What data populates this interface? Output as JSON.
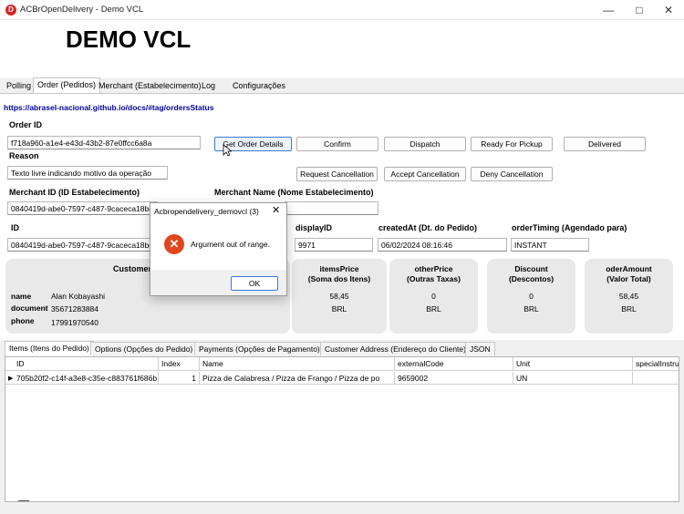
{
  "window": {
    "title": "ACBrOpenDelivery - Demo VCL"
  },
  "header": {
    "title": "DEMO VCL"
  },
  "tabs": [
    "Polling",
    "Order (Pedidos)",
    "Merchant (Estabelecimento)",
    "Log",
    "Configurações"
  ],
  "order": {
    "link": "https://abrasel-nacional.github.io/docs/#tag/ordersStatus",
    "order_id_label": "Order ID",
    "order_id": "f718a960-a1e4-e43d-43b2-87e0ffcc6a8a",
    "reason_label": "Reason",
    "reason": "Texto livre indicando motivo da operação",
    "merchant_id_label": "Merchant ID (ID Estabelecimento)",
    "merchant_id": "0840419d-abe0-7597-c487-9caceca18bed",
    "merchant_name_label": "Merchant Name (Nome Estabelecimento)",
    "merchant_name": "",
    "id_label": "ID",
    "id": "0840419d-abe0-7597-c487-9caceca18bed",
    "display_id_label": "displayID",
    "display_id": "9971",
    "created_label": "createdAt (Dt. do Pedido)",
    "created": "06/02/2024 08:16:46",
    "timing_label": "orderTiming (Agendado para)",
    "timing": "INSTANT"
  },
  "buttons": {
    "get_details": "Get Order Details",
    "confirm": "Confirm",
    "dispatch": "Dispatch",
    "ready": "Ready For Pickup",
    "delivered": "Delivered",
    "req_cancel": "Request Cancellation",
    "accept_cancel": "Accept Cancellation",
    "deny_cancel": "Deny Cancellation"
  },
  "customer": {
    "title": "Customer",
    "name_label": "name",
    "name": "Alan Kobayashi",
    "document_label": "document",
    "document": "35671283884",
    "phone_label": "phone",
    "phone": "17991970540"
  },
  "panels": [
    {
      "title1": "itemsPrice",
      "title2": "(Soma dos Itens)",
      "value": "58,45",
      "currency": "BRL"
    },
    {
      "title1": "otherPrice",
      "title2": "(Outras Taxas)",
      "value": "0",
      "currency": "BRL"
    },
    {
      "title1": "Discount",
      "title2": "(Descontos)",
      "value": "0",
      "currency": "BRL"
    },
    {
      "title1": "oderAmount",
      "title2": "(Valor Total)",
      "value": "58,45",
      "currency": "BRL"
    }
  ],
  "bottom_tabs": [
    "Items (Itens do Pedido)",
    "Options (Opções do Pedido)",
    "Payments (Opções de Pagamento)",
    "Customer Address (Endereço do Cliente)",
    "JSON"
  ],
  "grid": {
    "columns": [
      "ID",
      "Index",
      "Name",
      "externalCode",
      "Unit",
      "specialInstru"
    ],
    "rows": [
      [
        "705b20f2-c14f-a3e8-c35e-c883761f686b",
        "1",
        "Pizza de Calabresa / Pizza de Frango / Pizza de po",
        "9659002",
        "UN",
        ""
      ]
    ]
  },
  "dialog": {
    "title": "Acbropendelivery_demovcl (3)",
    "message": "Argument out of range.",
    "ok": "OK"
  }
}
